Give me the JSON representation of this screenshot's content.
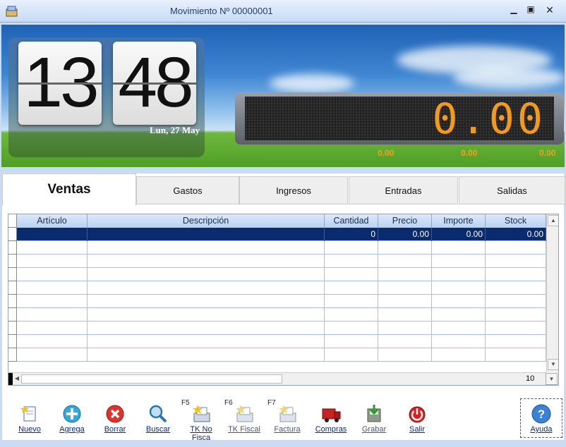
{
  "window": {
    "title": "Movimiento Nº 00000001",
    "controls": [
      "minimize",
      "maximize",
      "close"
    ]
  },
  "clock": {
    "hours": "13",
    "minutes": "48",
    "date": "Lun, 27 May"
  },
  "display": {
    "total": "0.00",
    "subtotals": [
      "0.00",
      "0.00",
      "0.00"
    ],
    "led_color": "#f39a1a"
  },
  "tabs": [
    {
      "label": "Ventas",
      "active": true
    },
    {
      "label": "Gastos",
      "active": false
    },
    {
      "label": "Ingresos",
      "active": false
    },
    {
      "label": "Entradas",
      "active": false
    },
    {
      "label": "Salidas",
      "active": false
    }
  ],
  "grid": {
    "columns": [
      "Artículo",
      "Descripción",
      "Cantidad",
      "Precio",
      "Importe",
      "Stock"
    ],
    "rows": [
      {
        "articulo": "",
        "descripcion": "",
        "cantidad": "0",
        "precio": "0.00",
        "importe": "0.00",
        "stock": "0.00"
      }
    ],
    "empty_rows": 10,
    "page_size": "10",
    "selection_color": "#0a2c6e"
  },
  "toolbar": {
    "nuevo": "Nuevo",
    "agrega": "Agrega",
    "borrar": "Borrar",
    "buscar": "Buscar",
    "tk_no_fiscal": "TK No Fisca",
    "tk_no_fiscal_key": "F5",
    "tk_fiscal": "TK Fiscal",
    "tk_fiscal_key": "F6",
    "factura": "Factura",
    "factura_key": "F7",
    "compras": "Compras",
    "grabar": "Grabar",
    "salir": "Salir",
    "ayuda": "Ayuda"
  }
}
